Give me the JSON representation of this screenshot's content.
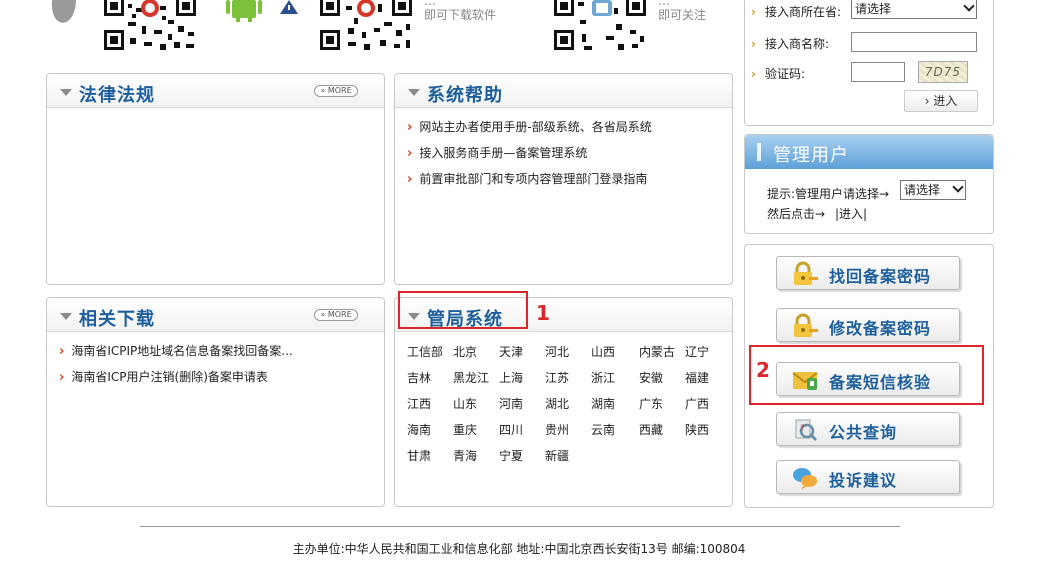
{
  "top": {
    "qr_captions": [
      {
        "line1": "…",
        "line2": "即可下载软件"
      },
      {
        "line1": "…",
        "line2": "即可关注"
      }
    ]
  },
  "panels": {
    "law": {
      "title": "法律法规",
      "more": "» MORE"
    },
    "help": {
      "title": "系统帮助",
      "items": [
        "网站主办者使用手册-部级系统、各省局系统",
        "接入服务商手册—备案管理系统",
        "前置审批部门和专项内容管理部门登录指南"
      ]
    },
    "download": {
      "title": "相关下载",
      "more": "» MORE",
      "items": [
        "海南省ICPIP地址域名信息备案找回备案...",
        "海南省ICP用户注销(删除)备案申请表"
      ]
    },
    "bureau": {
      "title": "管局系统",
      "provinces": [
        "工信部",
        "北京",
        "天津",
        "河北",
        "山西",
        "内蒙古",
        "辽宁",
        "吉林",
        "黑龙江",
        "上海",
        "江苏",
        "浙江",
        "安徽",
        "福建",
        "江西",
        "山东",
        "河南",
        "湖北",
        "湖南",
        "广东",
        "广西",
        "海南",
        "重庆",
        "四川",
        "贵州",
        "云南",
        "西藏",
        "陕西",
        "甘肃",
        "青海",
        "宁夏",
        "新疆"
      ]
    }
  },
  "login": {
    "province_label": "接入商所在省:",
    "province_select": "请选择",
    "name_label": "接入商名称:",
    "captcha_label": "验证码:",
    "captcha_text": "7D75",
    "enter_button": "› 进入"
  },
  "manager": {
    "title": "管理用户",
    "hint_label": "提示:管理用户请选择→",
    "select_value": "请选择",
    "then_text": "然后点击→",
    "enter_link": "|进入|"
  },
  "actions": [
    {
      "label": "找回备案密码",
      "icon": "lock-key-icon"
    },
    {
      "label": "修改备案密码",
      "icon": "lock-key-icon"
    },
    {
      "label": "备案短信核验",
      "icon": "sms-envelope-icon"
    },
    {
      "label": "公共查询",
      "icon": "query-magnifier-icon"
    },
    {
      "label": "投诉建议",
      "icon": "chat-bubble-icon"
    }
  ],
  "annotations": {
    "one": "1",
    "two": "2"
  },
  "footer": "主办单位:中华人民共和国工业和信息化部 地址:中国北京西长安街13号 邮编:100804",
  "colors": {
    "title_blue": "#1d5f9c",
    "annotation_red": "#d9272e",
    "manager_header": "#5da0d8"
  }
}
